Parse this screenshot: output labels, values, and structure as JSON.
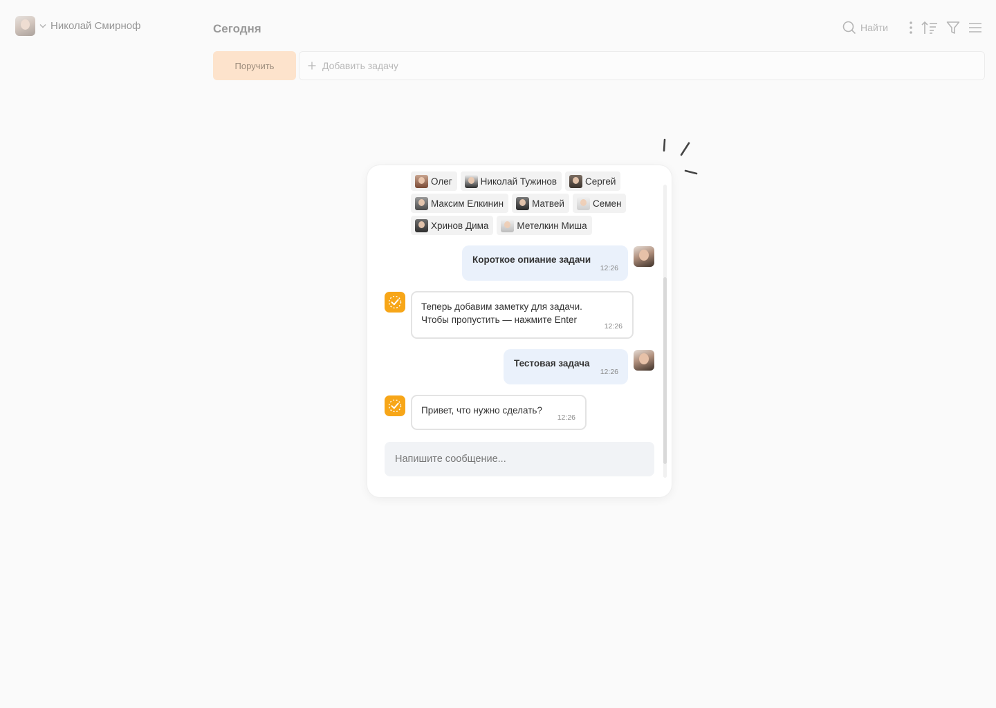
{
  "header": {
    "user_name": "Николай Смирноф",
    "page_title": "Сегодня",
    "search_label": "Найти",
    "assign_label": "Поручить",
    "add_task_placeholder": "Добавить задачу"
  },
  "chat": {
    "participants": [
      {
        "name": "Олег"
      },
      {
        "name": "Николай Тужинов"
      },
      {
        "name": "Сергей"
      },
      {
        "name": "Максим Елкинин"
      },
      {
        "name": "Матвей"
      },
      {
        "name": "Семен"
      },
      {
        "name": "Хринов Дима"
      },
      {
        "name": "Метелкин Миша"
      }
    ],
    "messages": [
      {
        "from": "user",
        "text": "Короткое опиание задачи",
        "time": "12:26"
      },
      {
        "from": "bot",
        "line1": "Теперь добавим заметку для задачи.",
        "line2": "Чтобы пропустить — нажмите Enter",
        "time": "12:26"
      },
      {
        "from": "user",
        "text": "Тестовая задача",
        "time": "12:26"
      },
      {
        "from": "bot",
        "text": "Привет, что нужно сделать?",
        "time": "12:26"
      }
    ],
    "composer_placeholder": "Напишите сообщение..."
  },
  "colors": {
    "accent_orange": "#f7a618",
    "assign_button_bg": "#fde3cc",
    "outgoing_bubble": "#eaf1fb",
    "composer_bg": "#f1f3f6"
  },
  "icons": [
    "chevron-down-icon",
    "search-icon",
    "more-vertical-icon",
    "sort-icon",
    "filter-icon",
    "menu-icon",
    "plus-icon",
    "bot-check-icon"
  ]
}
